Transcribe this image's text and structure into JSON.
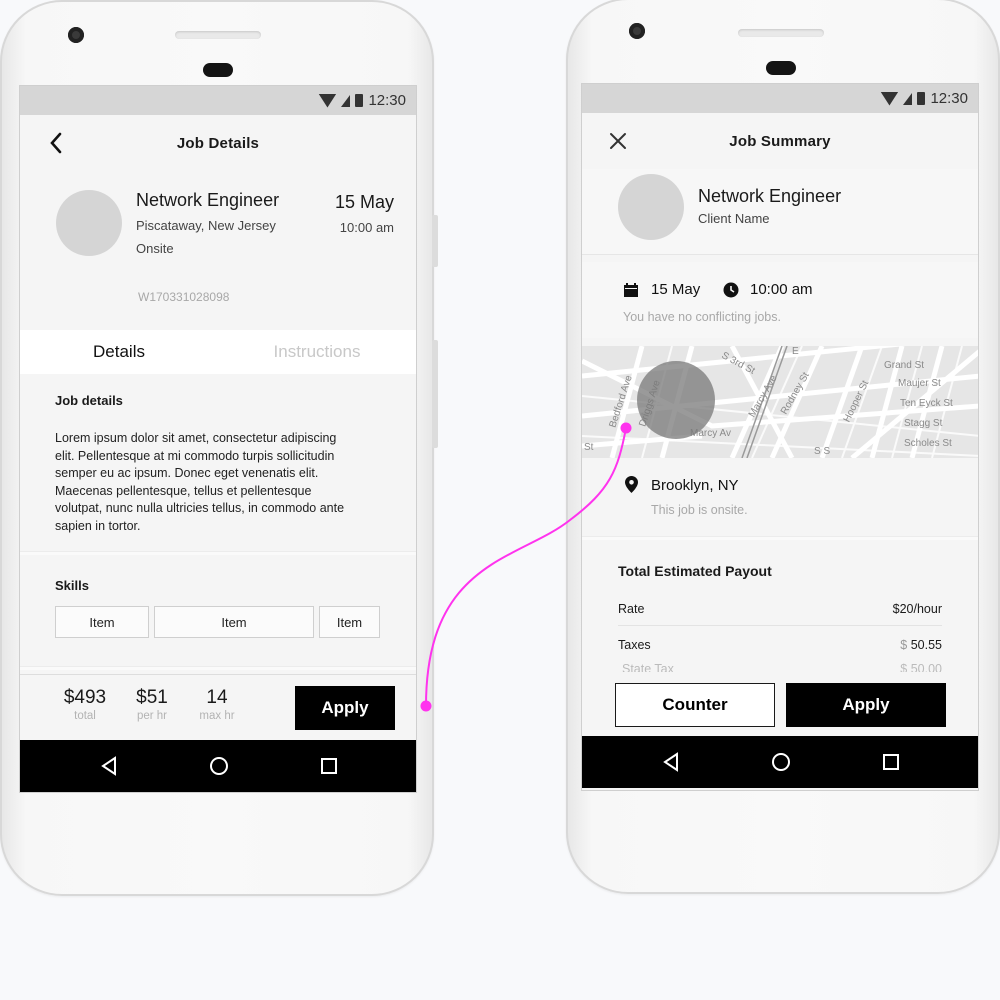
{
  "status": {
    "time": "12:30"
  },
  "left": {
    "title": "Job Details",
    "job": {
      "name": "Network Engineer",
      "location": "Piscataway, New Jersey",
      "type": "Onsite",
      "date": "15 May",
      "time": "10:00 am",
      "id": "W170331028098"
    },
    "tabs": [
      "Details",
      "Instructions"
    ],
    "job_details": {
      "heading": "Job details",
      "lines": [
        "Lorem ipsum dolor sit amet, consectetur adipiscing",
        "elit. Pellentesque at mi commodo turpis sollicitudin",
        "semper eu ac ipsum. Donec eget venenatis elit.",
        "Maecenas pellentesque, tellus et pellentesque",
        "volutpat, nunc nulla ultricies tellus, in commodo ante",
        "sapien in tortor."
      ]
    },
    "skills": {
      "heading": "Skills",
      "items": [
        "Item",
        "Item",
        "Item"
      ]
    },
    "stats": [
      {
        "value": "$493",
        "label": "total"
      },
      {
        "value": "$51",
        "label": "per hr"
      },
      {
        "value": "14",
        "label": "max hr"
      }
    ],
    "apply_label": "Apply"
  },
  "right": {
    "title": "Job Summary",
    "job": {
      "name": "Network Engineer",
      "client": "Client Name"
    },
    "schedule": {
      "date": "15 May",
      "time": "10:00 am",
      "note": "You have no conflicting jobs."
    },
    "map_labels": {
      "s3rd": "S 3rd St",
      "bedford": "Bedford Ave",
      "driggs": "Driggs Ave",
      "marcy_ave": "Marcy Ave",
      "marcy": "Marcy Av",
      "rodney": "Rodney St",
      "hooper": "Hooper St",
      "grand": "Grand St",
      "maujer": "Maujer St",
      "ten_eyck": "Ten Eyck St",
      "stagg": "Stagg St",
      "scholes": "Scholes St",
      "st": "St",
      "ss": "S S",
      "e": "E"
    },
    "location": {
      "place": "Brooklyn, NY",
      "note": "This job is onsite."
    },
    "payout": {
      "heading": "Total Estimated Payout",
      "rate_label": "Rate",
      "rate_value": "$20/hour",
      "taxes_label": "Taxes",
      "taxes_currency": "$",
      "taxes_value": "50.55",
      "state_tax_label": "State Tax",
      "state_tax_value": "$  50.00"
    },
    "counter_label": "Counter",
    "apply_label": "Apply"
  },
  "colors": {
    "accent": "#ff33ee",
    "primary_button": "#000000"
  }
}
